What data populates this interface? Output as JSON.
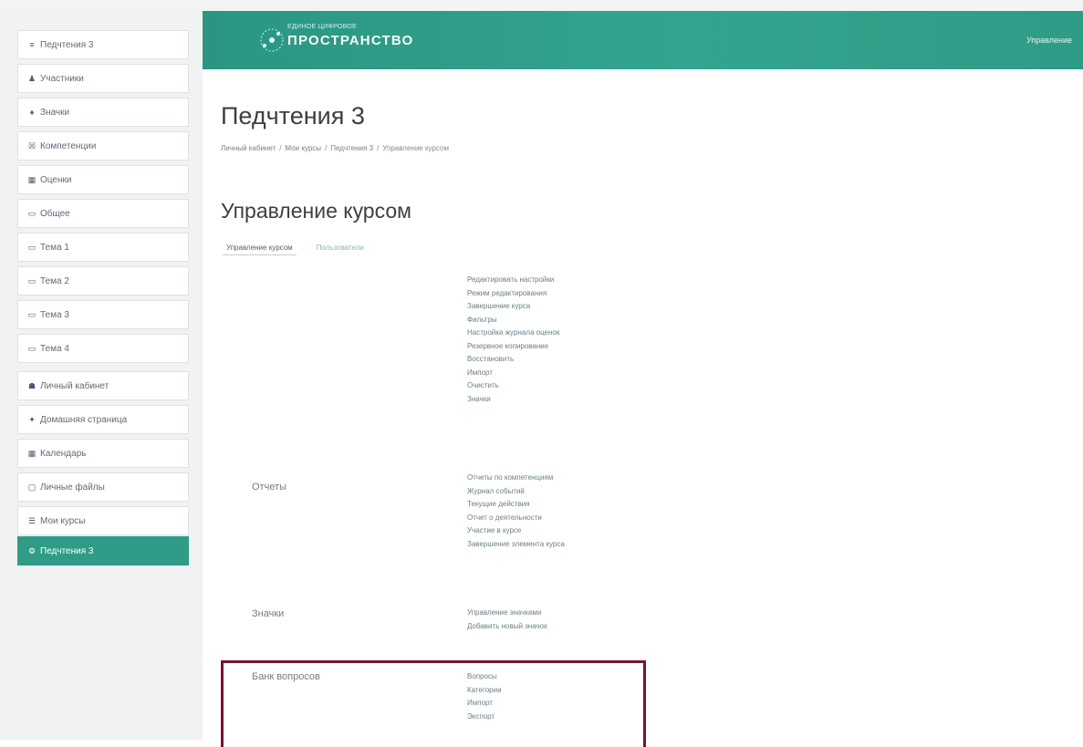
{
  "sidebar": {
    "items": [
      {
        "icon": "≡",
        "label": "Педчтения 3",
        "icon_name": "list-icon"
      },
      {
        "icon": "♟",
        "label": "Участники",
        "icon_name": "users-icon"
      },
      {
        "icon": "♦",
        "label": "Значки",
        "icon_name": "badge-icon"
      },
      {
        "icon": "☒",
        "label": "Компетенции",
        "icon_name": "competency-icon"
      },
      {
        "icon": "▦",
        "label": "Оценки",
        "icon_name": "grades-icon"
      },
      {
        "icon": "▭",
        "label": "Общее",
        "icon_name": "folder-icon"
      },
      {
        "icon": "▭",
        "label": "Тема 1",
        "icon_name": "folder-icon"
      },
      {
        "icon": "▭",
        "label": "Тема 2",
        "icon_name": "folder-icon"
      },
      {
        "icon": "▭",
        "label": "Тема 3",
        "icon_name": "folder-icon"
      },
      {
        "icon": "▭",
        "label": "Тема 4",
        "icon_name": "folder-icon"
      },
      {
        "icon": "☗",
        "label": "Личный кабинет",
        "icon_name": "dashboard-icon"
      },
      {
        "icon": "✦",
        "label": "Домашняя страница",
        "icon_name": "home-icon"
      },
      {
        "icon": "▦",
        "label": "Календарь",
        "icon_name": "calendar-icon"
      },
      {
        "icon": "▢",
        "label": "Личные файлы",
        "icon_name": "files-icon"
      },
      {
        "icon": "☰",
        "label": "Мои курсы",
        "icon_name": "courses-icon"
      },
      {
        "icon": "⚙",
        "label": "Педчтения 3",
        "icon_name": "course-icon"
      }
    ]
  },
  "header": {
    "logo_small": "ЕДИНОЕ ЦИФРОВОЕ",
    "logo_big": "ПРОСТРАНСТВО",
    "logo_sub": "",
    "user_label": "Управление"
  },
  "main": {
    "page_title": "Педчтения 3",
    "breadcrumb": [
      "Личный кабинет",
      "Мои курсы",
      "Педчтения 3",
      "Управление курсом"
    ],
    "section_title": "Управление курсом",
    "tabs": {
      "active": "Управление курсом",
      "inactive": "Пользователи"
    },
    "groups": {
      "course": {
        "label": "",
        "links": [
          "Редактировать настройки",
          "Режим редактирования",
          "Завершение курса",
          "Фильтры",
          "Настройка журнала оценок",
          "Резервное копирование",
          "Восстановить",
          "Импорт",
          "Очистить",
          "Значки"
        ]
      },
      "reports": {
        "label": "Отчеты",
        "links": [
          "Отчеты по компетенциям",
          "Журнал событий",
          "Текущие действия",
          "Отчет о деятельности",
          "Участие в курсе",
          "Завершение элемента курса"
        ]
      },
      "badges": {
        "label": "Значки",
        "links": [
          "Управление значками",
          "Добавить новый значок"
        ]
      },
      "question_bank": {
        "label": "Банк вопросов",
        "links": [
          "Вопросы",
          "Категории",
          "Импорт",
          "Экспорт"
        ]
      }
    }
  },
  "colors": {
    "accent": "#2e9c86",
    "highlight_border": "#7a1230"
  }
}
